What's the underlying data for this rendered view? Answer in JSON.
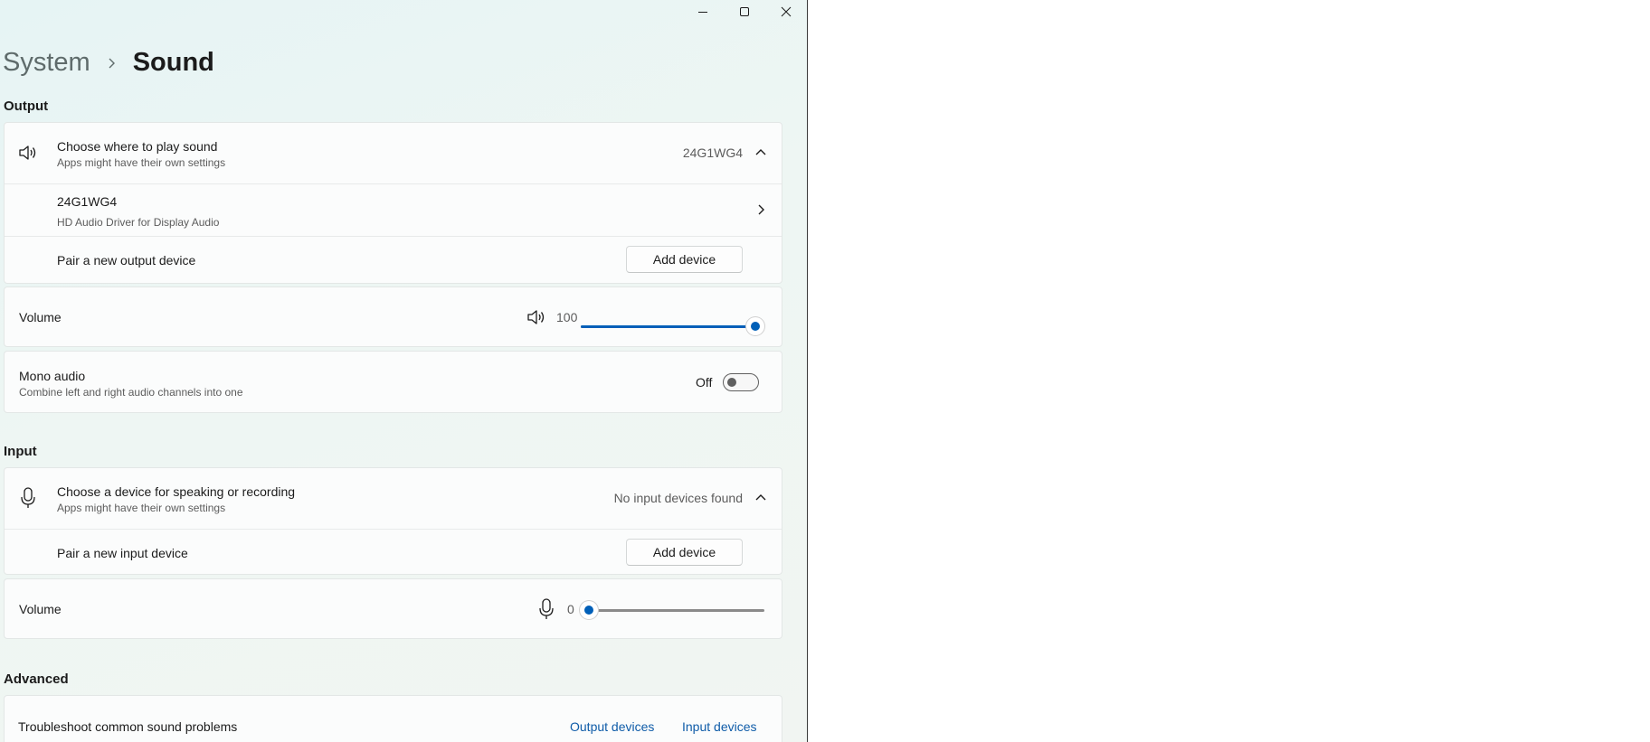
{
  "window": {
    "minimize_icon": "minimize-icon",
    "maximize_icon": "maximize-icon",
    "close_icon": "close-icon"
  },
  "breadcrumb": {
    "parent": "System",
    "current": "Sound"
  },
  "output": {
    "heading": "Output",
    "choose": {
      "title": "Choose where to play sound",
      "subtitle": "Apps might have their own settings",
      "selected": "24G1WG4"
    },
    "device": {
      "name": "24G1WG4",
      "driver": "HD Audio Driver for Display Audio"
    },
    "pair": {
      "label": "Pair a new output device",
      "button": "Add device"
    },
    "volume": {
      "label": "Volume",
      "value": "100",
      "level": 1.0
    },
    "mono": {
      "title": "Mono audio",
      "subtitle": "Combine left and right audio channels into one",
      "state": "Off"
    }
  },
  "input": {
    "heading": "Input",
    "choose": {
      "title": "Choose a device for speaking or recording",
      "subtitle": "Apps might have their own settings",
      "selected": "No input devices found"
    },
    "pair": {
      "label": "Pair a new input device",
      "button": "Add device"
    },
    "volume": {
      "label": "Volume",
      "value": "0",
      "level": 0.0
    }
  },
  "advanced": {
    "heading": "Advanced",
    "troubleshoot": {
      "label": "Troubleshoot common sound problems",
      "output_link": "Output devices",
      "input_link": "Input devices"
    }
  },
  "colors": {
    "accent": "#005fb8",
    "link": "#0f5ca8"
  }
}
